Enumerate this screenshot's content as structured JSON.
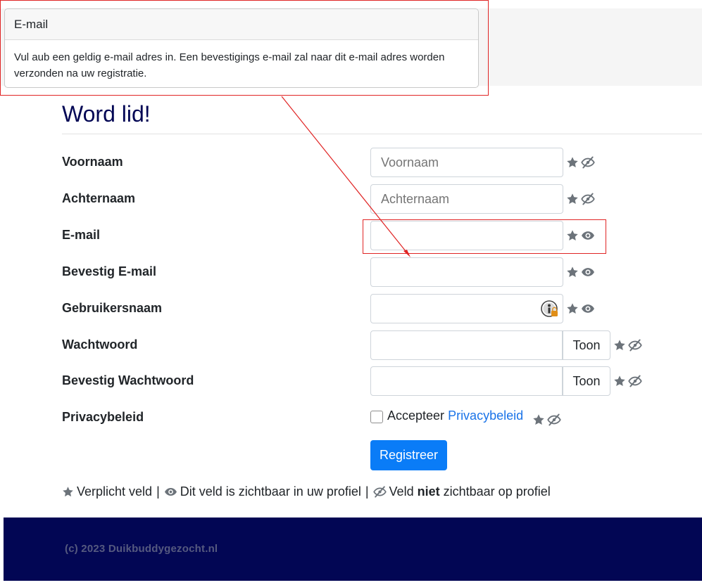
{
  "tooltip": {
    "title": "E-mail",
    "body": "Vul aub een geldig e-mail adres in. Een bevestigings e-mail zal naar dit e-mail adres worden verzonden na uw registratie."
  },
  "page": {
    "title": "Word lid!"
  },
  "form": {
    "voornaam": {
      "label": "Voornaam",
      "placeholder": "Voornaam"
    },
    "achternaam": {
      "label": "Achternaam",
      "placeholder": "Achternaam"
    },
    "email": {
      "label": "E-mail"
    },
    "email_confirm": {
      "label": "Bevestig E-mail"
    },
    "username": {
      "label": "Gebruikersnaam"
    },
    "password": {
      "label": "Wachtwoord",
      "toggle": "Toon"
    },
    "password_confirm": {
      "label": "Bevestig Wachtwoord",
      "toggle": "Toon"
    },
    "privacy": {
      "label": "Privacybeleid",
      "accept_text": "Accepteer",
      "link_text": "Privacybeleid"
    },
    "submit_label": "Registreer"
  },
  "legend": {
    "required": "Verplicht veld",
    "visible": "Dit veld is zichtbaar in uw profiel",
    "not_visible_prefix": "Veld",
    "not_visible_bold": "niet",
    "not_visible_suffix": "zichtbaar op profiel",
    "separator": "|"
  },
  "footer": {
    "copyright": "(c) 2023 Duikbuddygezocht.nl"
  },
  "icons": {
    "star": "star-icon",
    "eye": "eye-icon",
    "eye_slash": "eye-slash-icon",
    "password_manager": "password-manager-icon"
  },
  "colors": {
    "title": "#020654",
    "footer_bg": "#020654",
    "primary_button": "#0a7cf7",
    "link": "#1a73e8",
    "annotation": "#e02424"
  }
}
